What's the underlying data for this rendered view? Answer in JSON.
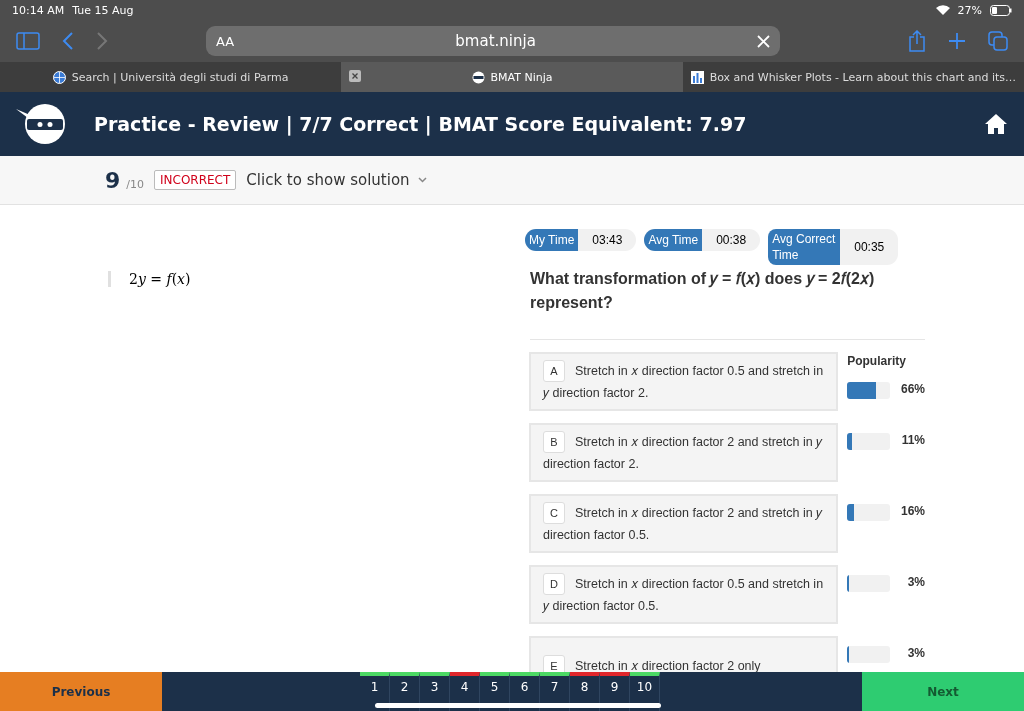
{
  "status_bar": {
    "time": "10:14 AM",
    "date": "Tue 15 Aug",
    "battery": "27%"
  },
  "browser": {
    "text_size": "AA",
    "address": "bmat.ninja",
    "tabs": [
      {
        "title": "Search | Università degli studi di Parma",
        "selected": false
      },
      {
        "title": "BMAT Ninja",
        "selected": true
      },
      {
        "title": "Box and Whisker Plots - Learn about this chart and its…",
        "selected": false
      }
    ]
  },
  "header": {
    "title": "Practice - Review | 7/7 Correct | BMAT Score Equivalent: 7.97"
  },
  "question_bar": {
    "number": "9",
    "total": "/10",
    "result": "INCORRECT",
    "solution_toggle": "Click to show solution"
  },
  "stem": "2𝑦 = 𝑓(𝑥)",
  "timers": [
    {
      "label": "My Time",
      "value": "03:43"
    },
    {
      "label": "Avg Time",
      "value": "00:38"
    },
    {
      "label": "Avg Correct Time",
      "value": "00:35"
    }
  ],
  "question": "What transformation of 𝑦 = 𝑓(𝑥) does 𝑦 = 2𝑓(2𝑥) represent?",
  "popularity_heading": "Popularity",
  "answers": [
    {
      "letter": "A",
      "text": "Stretch in 𝑥 direction factor 0.5 and stretch in 𝑦 direction factor 2.",
      "level": 0.66,
      "percent": "66%"
    },
    {
      "letter": "B",
      "text": "Stretch in 𝑥 direction factor 2 and stretch in 𝑦 direction factor 2.",
      "level": 0.11,
      "percent": "11%"
    },
    {
      "letter": "C",
      "text": "Stretch in 𝑥 direction factor 2 and stretch in 𝑦 direction factor 0.5.",
      "level": 0.16,
      "percent": "16%"
    },
    {
      "letter": "D",
      "text": "Stretch in 𝑥 direction factor 0.5 and stretch in 𝑦 direction factor 0.5.",
      "level": 0.03,
      "percent": "3%"
    },
    {
      "letter": "E",
      "text": "Stretch in 𝑥 direction factor 2 only",
      "level": 0.03,
      "percent": "3%"
    }
  ],
  "footer": {
    "previous": "Previous",
    "next": "Next",
    "questions": [
      {
        "label": "1",
        "correct": true
      },
      {
        "label": "2",
        "correct": true
      },
      {
        "label": "3",
        "correct": true
      },
      {
        "label": "4",
        "correct": false
      },
      {
        "label": "5",
        "correct": true
      },
      {
        "label": "6",
        "correct": true
      },
      {
        "label": "7",
        "correct": true
      },
      {
        "label": "8",
        "correct": false
      },
      {
        "label": "9",
        "correct": false
      },
      {
        "label": "10",
        "correct": true
      }
    ]
  }
}
